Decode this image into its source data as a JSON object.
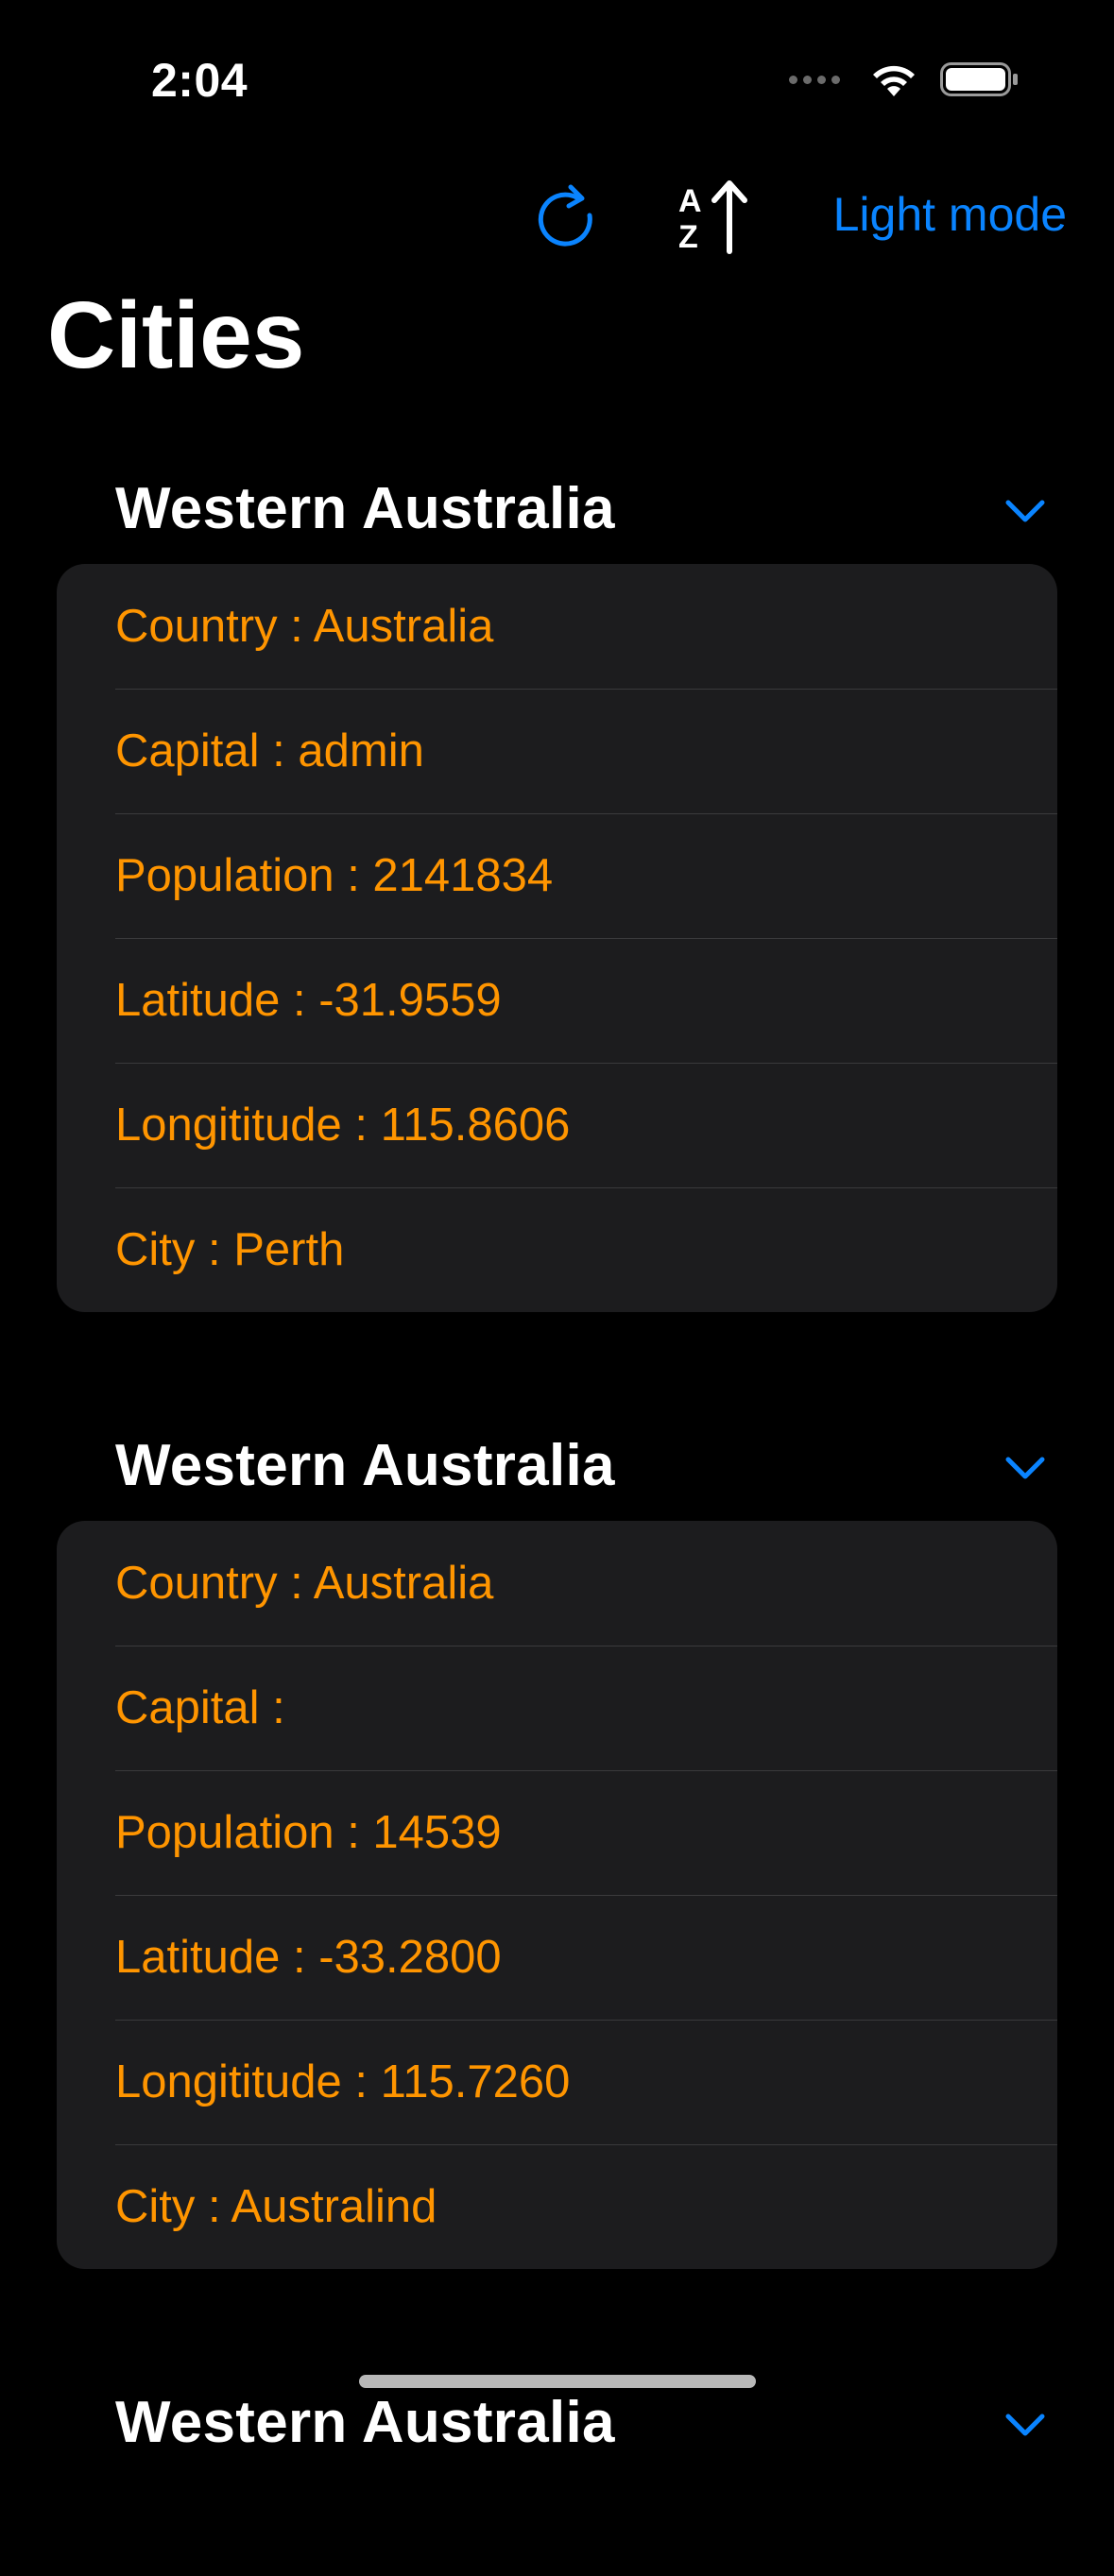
{
  "status": {
    "time": "2:04"
  },
  "toolbar": {
    "refresh_icon": "refresh-icon",
    "sort_icon": "sort-az-up-icon",
    "sort_letter_top": "A",
    "sort_letter_bottom": "Z",
    "light_mode_label": "Light mode"
  },
  "page": {
    "title": "Cities"
  },
  "colors": {
    "background": "#000000",
    "card": "#1c1c1e",
    "accent_blue": "#0a84ff",
    "field_orange": "#ff9500",
    "separator": "#3a3a3c"
  },
  "sections": [
    {
      "title": "Western Australia",
      "rows": [
        "Country : Australia",
        "Capital : admin",
        "Population : 2141834",
        "Latitude : -31.9559",
        "Longititude : 115.8606",
        "City : Perth"
      ]
    },
    {
      "title": "Western Australia",
      "rows": [
        "Country : Australia",
        "Capital : ",
        "Population : 14539",
        "Latitude : -33.2800",
        "Longititude : 115.7260",
        "City : Australind"
      ]
    },
    {
      "title": "Western Australia",
      "rows": []
    }
  ]
}
